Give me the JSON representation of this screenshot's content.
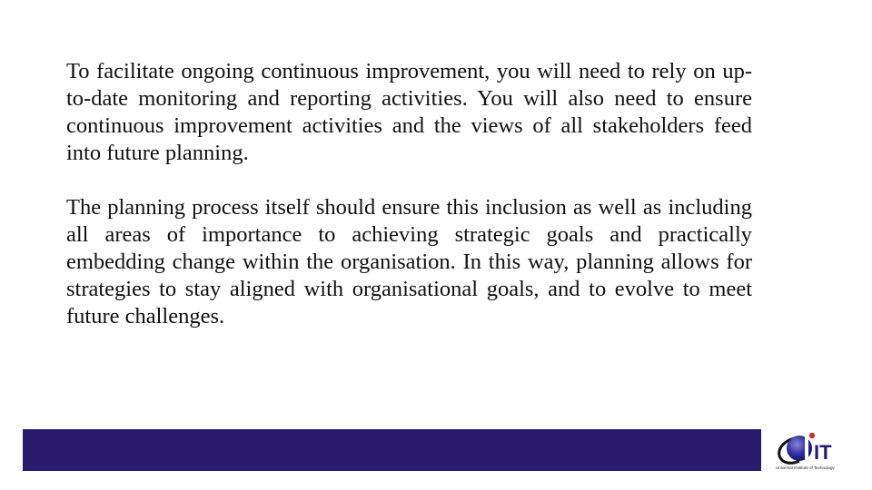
{
  "slide": {
    "paragraphs": [
      "To facilitate ongoing continuous improvement, you will need to rely on up-to-date monitoring and reporting activities. You will also need to ensure continuous improvement activities and the views of all stakeholders feed into future planning.",
      "The planning process itself should ensure this inclusion as well as including all areas of importance to achieving strategic goals and practically embedding change within the organisation. In this way, planning allows for strategies to stay aligned with organisational goals, and to evolve to meet future challenges."
    ]
  },
  "footer": {
    "bar_color": "#2a1a6e",
    "logo": {
      "text": "IT",
      "tagline": "Universal Institute of Technology",
      "accent_color": "#2a1a6e",
      "dot_color": "#c0392b"
    }
  }
}
